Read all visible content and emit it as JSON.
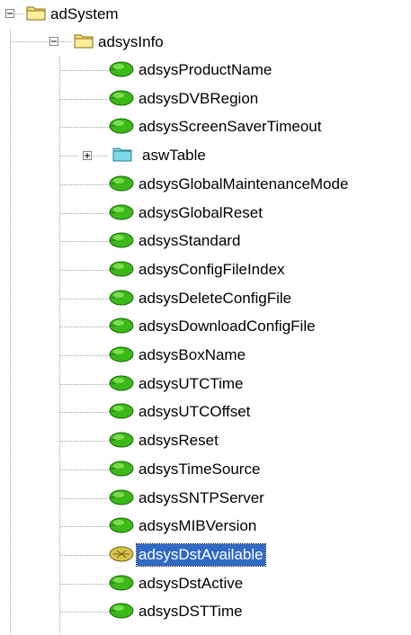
{
  "tree": {
    "root": {
      "label": "adSystem",
      "icon": "folder-open-icon",
      "expanded": true,
      "child": {
        "label": "adsysInfo",
        "icon": "folder-open-icon",
        "expanded": true,
        "items": [
          {
            "label": "adsysProductName",
            "icon": "leaf-icon"
          },
          {
            "label": "adsysDVBRegion",
            "icon": "leaf-icon"
          },
          {
            "label": "adsysScreenSaverTimeout",
            "icon": "leaf-icon"
          },
          {
            "label": "aswTable",
            "icon": "table-folder-icon",
            "expanded": false
          },
          {
            "label": "adsysGlobalMaintenanceMode",
            "icon": "leaf-icon"
          },
          {
            "label": "adsysGlobalReset",
            "icon": "leaf-icon"
          },
          {
            "label": "adsysStandard",
            "icon": "leaf-icon"
          },
          {
            "label": "adsysConfigFileIndex",
            "icon": "leaf-icon"
          },
          {
            "label": "adsysDeleteConfigFile",
            "icon": "leaf-icon"
          },
          {
            "label": "adsysDownloadConfigFile",
            "icon": "leaf-icon"
          },
          {
            "label": "adsysBoxName",
            "icon": "leaf-icon"
          },
          {
            "label": "adsysUTCTime",
            "icon": "leaf-icon"
          },
          {
            "label": "adsysUTCOffset",
            "icon": "leaf-icon"
          },
          {
            "label": "adsysReset",
            "icon": "leaf-icon"
          },
          {
            "label": "adsysTimeSource",
            "icon": "leaf-icon"
          },
          {
            "label": "adsysSNTPServer",
            "icon": "leaf-icon"
          },
          {
            "label": "adsysMIBVersion",
            "icon": "leaf-icon"
          },
          {
            "label": "adsysDstAvailable",
            "icon": "leaf-selected-icon",
            "selected": true
          },
          {
            "label": "adsysDstActive",
            "icon": "leaf-icon"
          },
          {
            "label": "adsysDSTTime",
            "icon": "leaf-icon"
          }
        ]
      }
    }
  },
  "colors": {
    "selection": "#316ac5",
    "leaf_green": "#3cb818",
    "folder_yellow": "#f6e07a",
    "table_cyan": "#7fd8e8"
  }
}
